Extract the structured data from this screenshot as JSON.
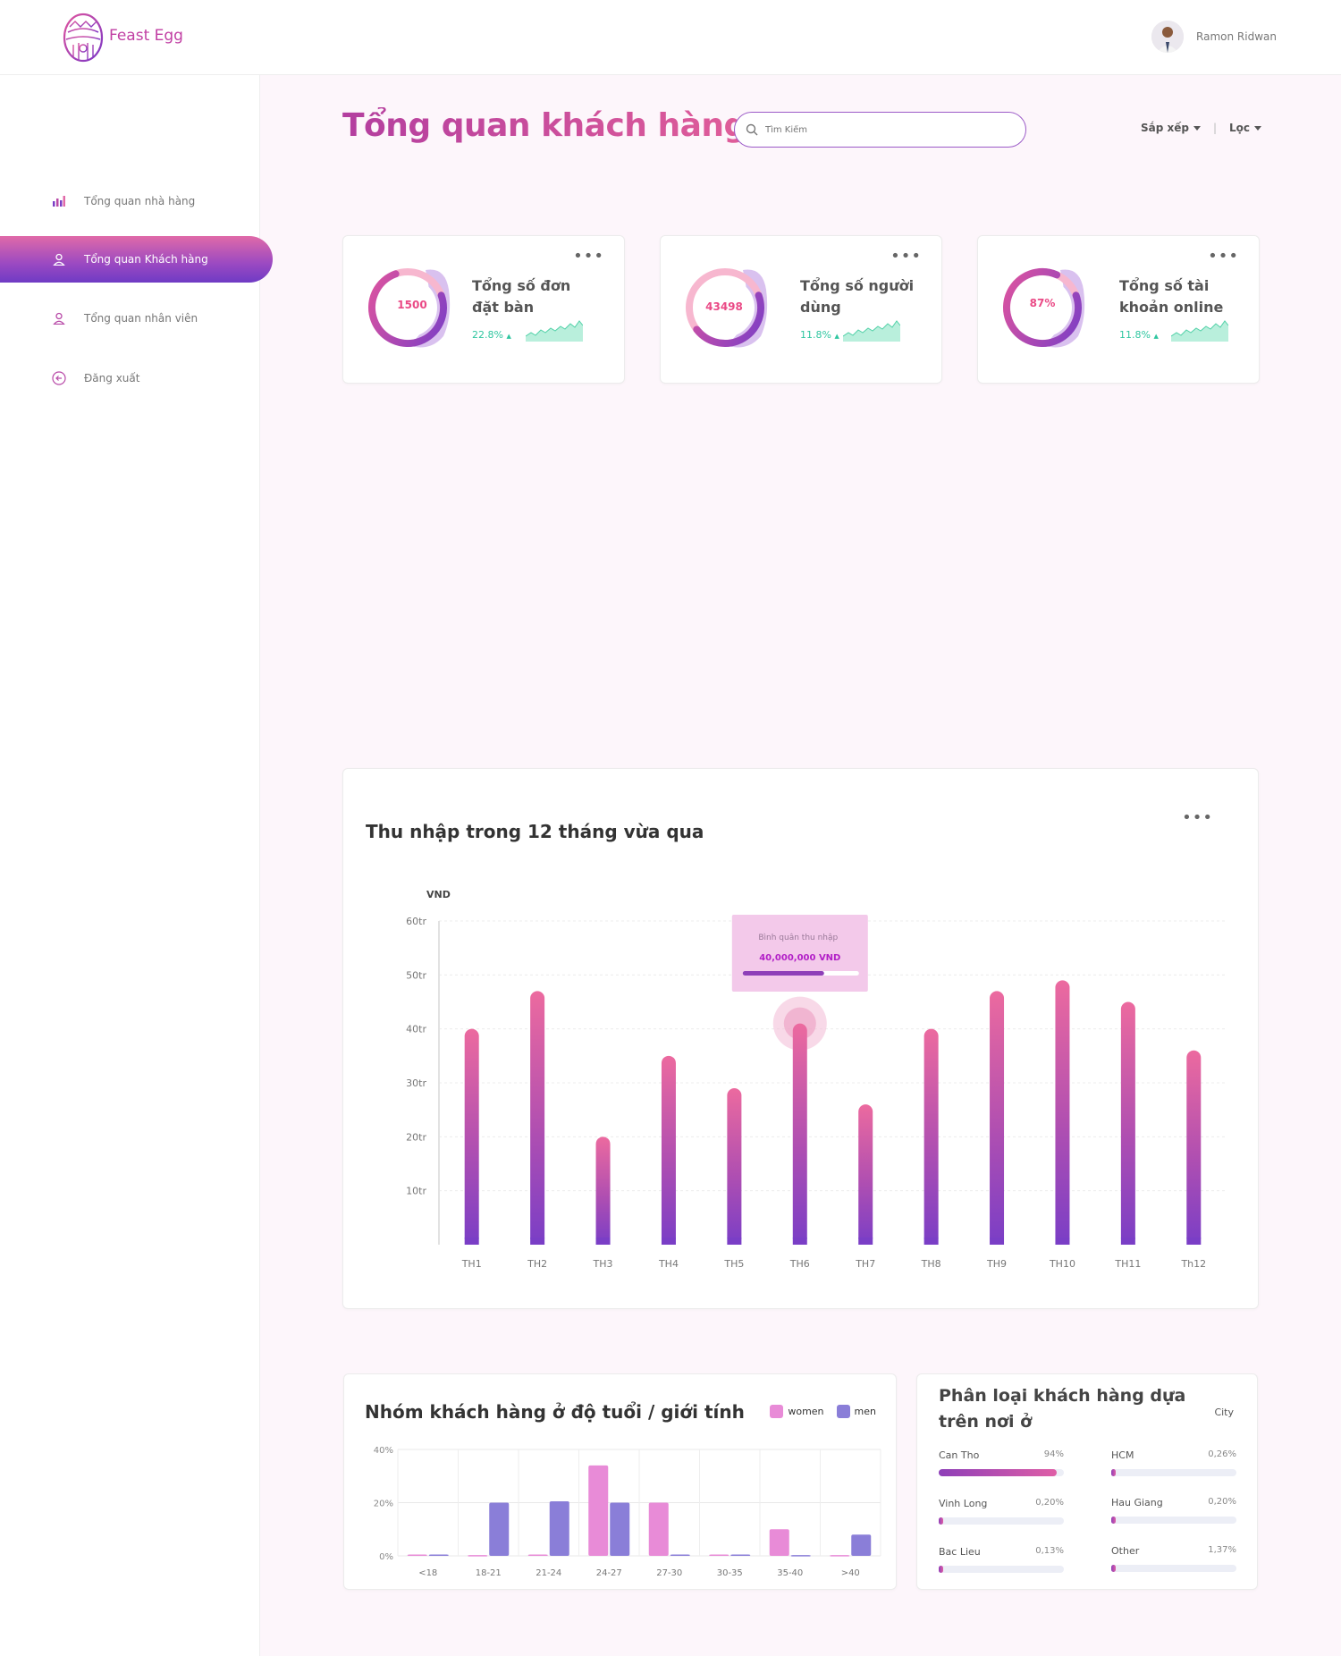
{
  "app": {
    "brand": "Feast Egg"
  },
  "user": {
    "name": "Ramon Ridwan"
  },
  "sidebar": {
    "items": [
      {
        "label": "Tổng quan nhà hàng",
        "icon": "bar-chart-icon",
        "active": false
      },
      {
        "label": "Tổng quan Khách hàng",
        "icon": "user-icon",
        "active": true
      },
      {
        "label": "Tổng quan nhân viên",
        "icon": "staff-icon",
        "active": false
      },
      {
        "label": "Đăng xuất",
        "icon": "logout-icon",
        "active": false
      }
    ]
  },
  "header": {
    "title": "Tổng quan khách hàng",
    "search_placeholder": "Tìm Kiếm",
    "sort_label": "Sắp xếp",
    "filter_label": "Lọc"
  },
  "stats": [
    {
      "value": "1500",
      "label": "Tổng số đơn đặt bàn",
      "change": "22.8%",
      "trend": "up",
      "progress": 0.75
    },
    {
      "value": "43498",
      "label": "Tổng số người dùng",
      "change": "11.8%",
      "trend": "up",
      "progress": 0.45
    },
    {
      "value": "87%",
      "label": "Tổng số tài khoản online",
      "change": "11.8%",
      "trend": "up",
      "progress": 0.87
    }
  ],
  "colors": {
    "accent": "#c13fa3",
    "pink": "#e86aa3",
    "purple": "#7a3ec6",
    "green": "#2fc6a0",
    "women": "#e88bd7",
    "men": "#8a7ed8"
  },
  "chart_data": [
    {
      "type": "bar",
      "title": "Thu nhập trong 12 tháng vừa qua",
      "ylabel": "VND",
      "ylim": [
        0,
        60
      ],
      "yticks": [
        "10tr",
        "20tr",
        "30tr",
        "40tr",
        "50tr",
        "60tr"
      ],
      "categories": [
        "TH1",
        "TH2",
        "TH3",
        "TH4",
        "TH5",
        "TH6",
        "TH7",
        "TH8",
        "TH9",
        "TH10",
        "TH11",
        "Th12"
      ],
      "values": [
        40,
        47,
        20,
        35,
        29,
        41,
        26,
        40,
        47,
        49,
        45,
        36
      ],
      "highlight_index": 5,
      "tooltip": {
        "label": "Bình quân thu nhập",
        "value": "40,000,000 VND",
        "progress": 0.7
      }
    },
    {
      "type": "bar",
      "title": "Nhóm khách hàng ở độ tuổi / giới tính",
      "ylim": [
        0,
        40
      ],
      "yticks": [
        "0%",
        "20%",
        "40%"
      ],
      "categories": [
        "<18",
        "18-21",
        "21-24",
        "24-27",
        "27-30",
        "30-35",
        "35-40",
        ">40"
      ],
      "series": [
        {
          "name": "women",
          "values": [
            0.5,
            0.3,
            0.5,
            34,
            20,
            0.5,
            10,
            0.3
          ]
        },
        {
          "name": "men",
          "values": [
            0.5,
            20,
            20.5,
            20,
            0.5,
            0.5,
            0.3,
            8
          ]
        }
      ],
      "legend": "top-right"
    }
  ],
  "city": {
    "title": "Phân loại khách hàng dựa trên nơi ở",
    "column_label": "City",
    "items": [
      {
        "name": "Can Tho",
        "pct": "94%",
        "value": 0.94
      },
      {
        "name": "HCM",
        "pct": "0,26%",
        "value": 0.0026
      },
      {
        "name": "Vinh Long",
        "pct": "0,20%",
        "value": 0.002
      },
      {
        "name": "Hau Giang",
        "pct": "0,20%",
        "value": 0.002
      },
      {
        "name": "Bac Lieu",
        "pct": "0,13%",
        "value": 0.0013
      },
      {
        "name": "Other",
        "pct": "1,37%",
        "value": 0.0137
      }
    ]
  }
}
